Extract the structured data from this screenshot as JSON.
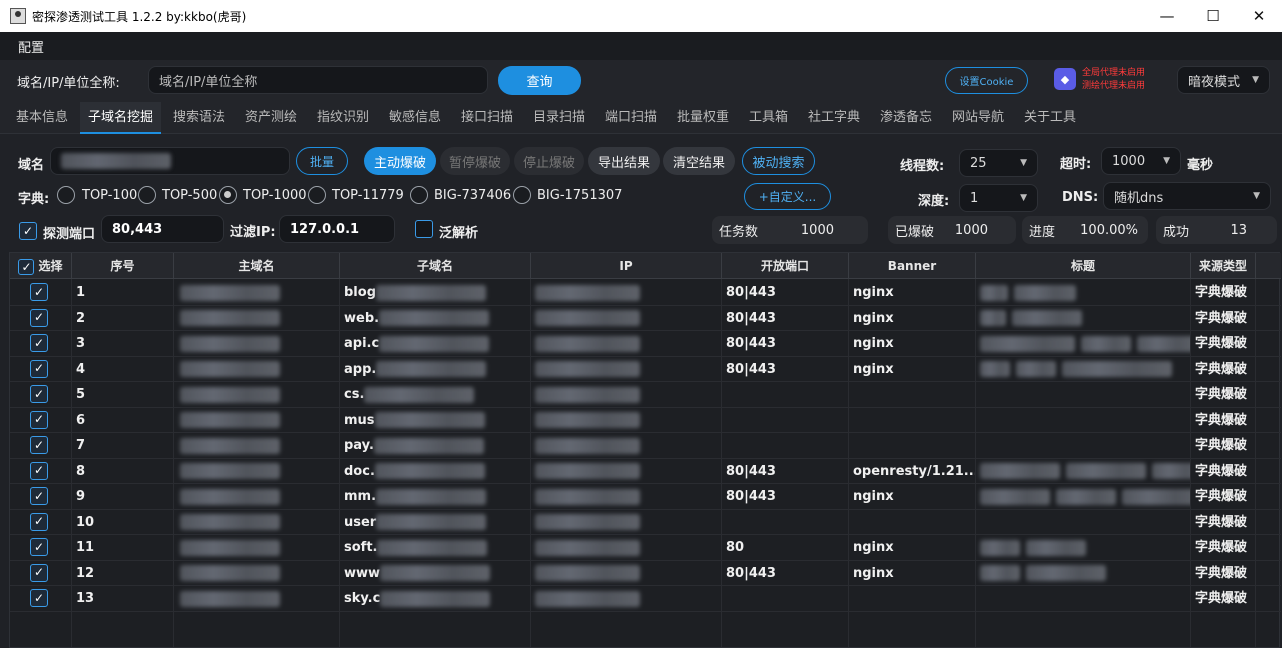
{
  "window": {
    "title": "密探渗透测试工具 1.2.2 by:kkbo(虎哥)",
    "minimize": "—",
    "maximize": "☐",
    "close": "✕"
  },
  "menu": {
    "config": "配置"
  },
  "query": {
    "label": "域名/IP/单位全称:",
    "placeholder": "域名/IP/单位全称",
    "button": "查询",
    "cookie_button": "设置Cookie",
    "proxy_line1": "全局代理未启用",
    "proxy_line2": "测绘代理未启用",
    "theme": "暗夜模式"
  },
  "tabs": [
    "基本信息",
    "子域名挖掘",
    "搜索语法",
    "资产测绘",
    "指纹识别",
    "敏感信息",
    "接口扫描",
    "目录扫描",
    "端口扫描",
    "批量权重",
    "工具箱",
    "社工字典",
    "渗透备忘",
    "网站导航",
    "关于工具"
  ],
  "panel": {
    "domain_label": "域名",
    "batch": "批量",
    "active_brute": "主动爆破",
    "pause_brute": "暂停爆破",
    "stop_brute": "停止爆破",
    "export": "导出结果",
    "clear": "清空结果",
    "passive": "被动搜索",
    "dict_label": "字典:",
    "dicts": [
      "TOP-100",
      "TOP-500",
      "TOP-1000",
      "TOP-11779",
      "BIG-737406",
      "BIG-1751307"
    ],
    "custom": "+自定义...",
    "threads_label": "线程数:",
    "threads": "25",
    "timeout_label": "超时:",
    "timeout": "1000",
    "timeout_unit": "毫秒",
    "depth_label": "深度:",
    "depth": "1",
    "dns_label": "DNS:",
    "dns": "随机dns",
    "port_check_label": "探测端口",
    "ports": "80,443",
    "filter_ip_label": "过滤IP:",
    "filter_ip": "127.0.0.1",
    "wildcard_label": "泛解析",
    "tasks_label": "任务数",
    "tasks": "1000",
    "done_label": "已爆破",
    "done": "1000",
    "progress_label": "进度",
    "progress": "100.00%",
    "success_label": "成功",
    "success": "13"
  },
  "table": {
    "headers": [
      "选择",
      "序号",
      "主域名",
      "子域名",
      "IP",
      "开放端口",
      "Banner",
      "标题",
      "来源类型"
    ],
    "rows": [
      {
        "n": "1",
        "sub": "blog",
        "port": "80|443",
        "banner": "nginx",
        "src": "字典爆破"
      },
      {
        "n": "2",
        "sub": "web.",
        "port": "80|443",
        "banner": "nginx",
        "src": "字典爆破"
      },
      {
        "n": "3",
        "sub": "api.c",
        "port": "80|443",
        "banner": "nginx",
        "src": "字典爆破"
      },
      {
        "n": "4",
        "sub": "app.",
        "port": "80|443",
        "banner": "nginx",
        "src": "字典爆破"
      },
      {
        "n": "5",
        "sub": "cs.",
        "port": "",
        "banner": "",
        "src": "字典爆破"
      },
      {
        "n": "6",
        "sub": "mus",
        "port": "",
        "banner": "",
        "src": "字典爆破"
      },
      {
        "n": "7",
        "sub": "pay.",
        "port": "",
        "banner": "",
        "src": "字典爆破"
      },
      {
        "n": "8",
        "sub": "doc.",
        "port": "80|443",
        "banner": "openresty/1.21....",
        "src": "字典爆破"
      },
      {
        "n": "9",
        "sub": "mm.",
        "port": "80|443",
        "banner": "nginx",
        "src": "字典爆破"
      },
      {
        "n": "10",
        "sub": "user",
        "port": "",
        "banner": "",
        "src": "字典爆破"
      },
      {
        "n": "11",
        "sub": "soft.",
        "port": "80",
        "banner": "nginx",
        "src": "字典爆破"
      },
      {
        "n": "12",
        "sub": "www",
        "port": "80|443",
        "banner": "nginx",
        "src": "字典爆破"
      },
      {
        "n": "13",
        "sub": "sky.c",
        "port": "",
        "banner": "",
        "src": "字典爆破"
      }
    ]
  },
  "colors": {
    "accent": "#1e8fe0",
    "bg": "#1f2126",
    "warn": "#ff3b3b"
  },
  "icons": {
    "check": "✓",
    "caret": "▼"
  }
}
